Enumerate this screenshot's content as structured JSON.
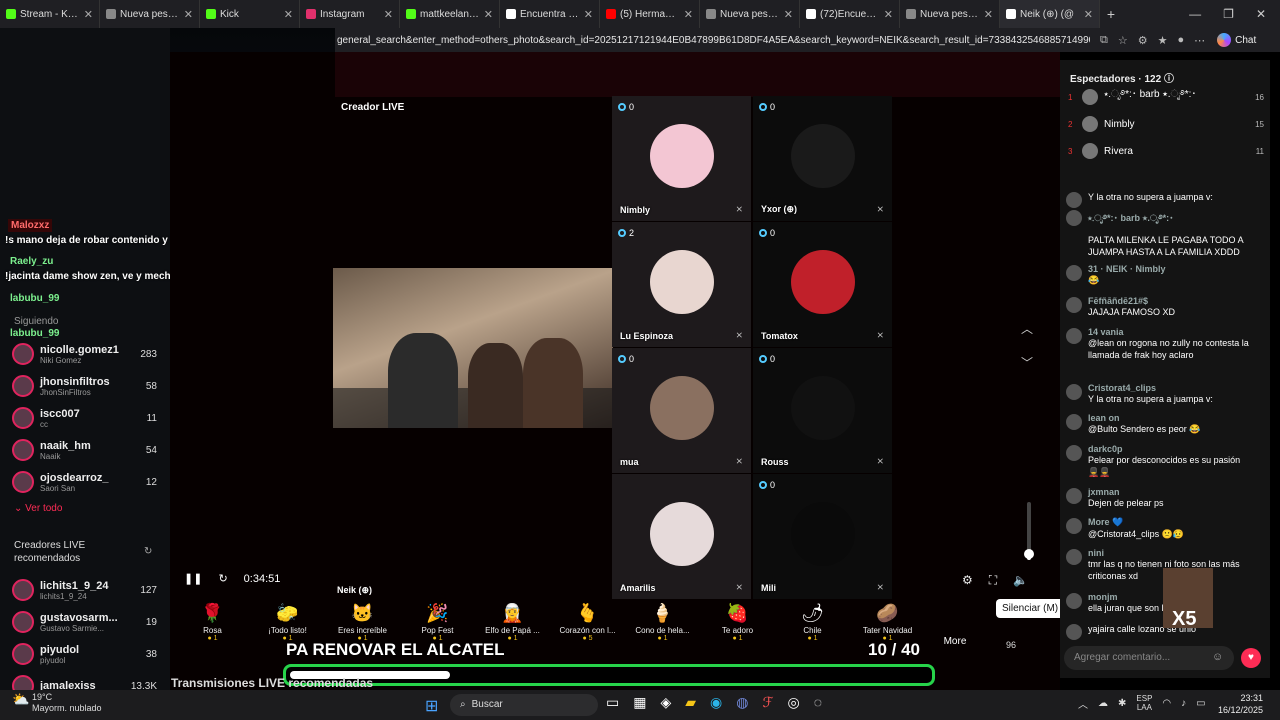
{
  "browser": {
    "tabs": [
      {
        "label": "Stream - Kick Das",
        "color": "#53fc18"
      },
      {
        "label": "Nueva pestaña",
        "color": "#888888"
      },
      {
        "label": "Kick",
        "color": "#53fc18"
      },
      {
        "label": "Instagram",
        "color": "#e1306c"
      },
      {
        "label": "mattkeelan Strean",
        "color": "#53fc18"
      },
      {
        "label": "Encuentra 'OSCAR",
        "color": "#ffffff"
      },
      {
        "label": "(5) Hermanos Yaj",
        "color": "#ff0000"
      },
      {
        "label": "Nueva pestaña",
        "color": "#888888"
      },
      {
        "label": "(72)Encuentra 'AR",
        "color": "#ffffff"
      },
      {
        "label": "Nueva pestaña",
        "color": "#888888"
      },
      {
        "label": "Neik (⊕) (@",
        "color": "#ffffff"
      }
    ],
    "new_tab": "+",
    "url": "general_search&enter_method=others_photo&search_id=20251217121944E0B47899B61D8DF4A5EA&search_keyword=NEIK&search_result_id=7338432546885714990&search_type...",
    "chat_label": "Chat"
  },
  "sidebar": {
    "overlay": {
      "user1": "Malozxz",
      "msg1": "!s mano deja de robar contenido y haz el tuyo p",
      "user2": "Raely_zu",
      "msg2": "!jacinta dame show zen, ve y mechate con Jhon",
      "user3": "labubu_99",
      "user4": "labubu_99"
    },
    "following_label": "Siguiendo",
    "following": [
      {
        "name": "nicolle.gomez1",
        "sub": "Niki Gomez",
        "count": "283"
      },
      {
        "name": "jhonsinfiltros",
        "sub": "JhonSinFiltros",
        "count": "58"
      },
      {
        "name": "iscc007",
        "sub": "cc",
        "count": "11"
      },
      {
        "name": "naaik_hm",
        "sub": "Naaik",
        "count": "54"
      },
      {
        "name": "ojosdearroz_",
        "sub": "Saori San",
        "count": "12"
      }
    ],
    "see_all": "Ver todo",
    "recommended_title": "Creadores LIVE recomendados",
    "recommended": [
      {
        "name": "lichits1_9_24",
        "sub": "lichits1_9_24",
        "count": "127"
      },
      {
        "name": "gustavosarm...",
        "sub": "Gustavo Sarmie...",
        "count": "19"
      },
      {
        "name": "piyudol",
        "sub": "piyudol",
        "count": "38"
      },
      {
        "name": "jamalexiss",
        "sub": "",
        "count": "13.3K"
      }
    ]
  },
  "stream": {
    "creator_live": "Creador LIVE",
    "host_name": "Neik (⊕)",
    "tiles": [
      {
        "badge": "0",
        "label": "Nimbly",
        "color": "#f3c6d3"
      },
      {
        "badge": "0",
        "label": "Yxor (⊕)",
        "color": "#1a1a1a"
      },
      {
        "badge": "2",
        "label": "Lu Espinoza",
        "color": "#e8d6d0"
      },
      {
        "badge": "0",
        "label": "Tomatox",
        "color": "#c0202a"
      },
      {
        "badge": "0",
        "label": "mua",
        "color": "#8a7060"
      },
      {
        "badge": "0",
        "label": "Rouss",
        "color": "#111111"
      },
      {
        "badge": "",
        "label": "Amarilis",
        "color": "#e6dada"
      },
      {
        "badge": "0",
        "label": "Mili",
        "color": "#0a0a0a"
      }
    ],
    "time": "0:34:51",
    "volume_level": 0.1,
    "mute_tooltip": "Silenciar (M)",
    "banner": "PA RENOVAR EL ALCATEL",
    "counter": "10 / 40",
    "progress": 0.25,
    "bottom_title": "Transmisiones LIVE recomendadas",
    "gift_count": "96"
  },
  "gifts": [
    {
      "name": "Rosa",
      "price": "1",
      "icon": "🌹"
    },
    {
      "name": "¡Todo listo!",
      "price": "1",
      "icon": "🧽"
    },
    {
      "name": "Eres increíble",
      "price": "1",
      "icon": "🐱"
    },
    {
      "name": "Pop Fest",
      "price": "1",
      "icon": "🎉"
    },
    {
      "name": "Elfo de Papá ...",
      "price": "1",
      "icon": "🧝"
    },
    {
      "name": "Corazón con l...",
      "price": "5",
      "icon": "🫰"
    },
    {
      "name": "Cono de hela...",
      "price": "1",
      "icon": "🍦"
    },
    {
      "name": "Te adoro",
      "price": "1",
      "icon": "🍓"
    },
    {
      "name": "Chile",
      "price": "1",
      "icon": "🌶"
    },
    {
      "name": "Tater Navidad",
      "price": "1",
      "icon": "🥔"
    }
  ],
  "gifts_more": "More",
  "chat": {
    "viewers_label": "Espectadores · 122",
    "top": [
      {
        "rank": "1",
        "name": "⭑.ೃ࿔*:･ barb ⭑.ೃ࿔*:･",
        "score": "16"
      },
      {
        "rank": "2",
        "name": "Nimbly",
        "score": "15"
      },
      {
        "rank": "3",
        "name": "Rivera",
        "score": "11"
      }
    ],
    "comments": [
      {
        "user": "",
        "text": "Y la otra no supera a juampa v:"
      },
      {
        "user": "⭑.ೃ࿔*:･ barb ⭑.ೃ࿔*:･",
        "text": "PALTA MILENKA LE PAGABA TODO A JUAMPA HASTA A LA FAMILIA XDDD"
      },
      {
        "user": "31 · NEIK · Nimbly",
        "text": "😂"
      },
      {
        "user": "Fēfñāñdē21#$",
        "text": "JAJAJA FAMOSO XD"
      },
      {
        "user": "14 vania",
        "text": "@lean on rogona no zully no contesta la llamada de frak hoy aclaro"
      },
      {
        "user": "Cristorat4_clips",
        "text": "Y la otra no supera a juampa v:"
      },
      {
        "user": "lean on",
        "text": "@Bulto Sendero es peor 😂"
      },
      {
        "user": "darkc0p",
        "text": "Pelear por desconocidos es su pasión 💂💂"
      },
      {
        "user": "jxmnan",
        "text": "Dejen de pelear ps"
      },
      {
        "user": "More 💙",
        "text": "@Cristorat4_clips 🙁😥"
      },
      {
        "user": "nini",
        "text": "tmr las q no tienen ni foto son las más criticonas xd"
      },
      {
        "user": "monjm",
        "text": "ella juran que son la verdad 💜"
      },
      {
        "user": "",
        "text": "yajaira calle lozano se unió"
      }
    ],
    "x5": "X5",
    "comment_placeholder": "Agregar comentario..."
  },
  "taskbar": {
    "temp": "19°C",
    "weather": "Mayorm. nublado",
    "search": "Buscar",
    "lang1": "ESP",
    "lang2": "LAA",
    "time": "23:31",
    "date": "16/12/2025"
  }
}
